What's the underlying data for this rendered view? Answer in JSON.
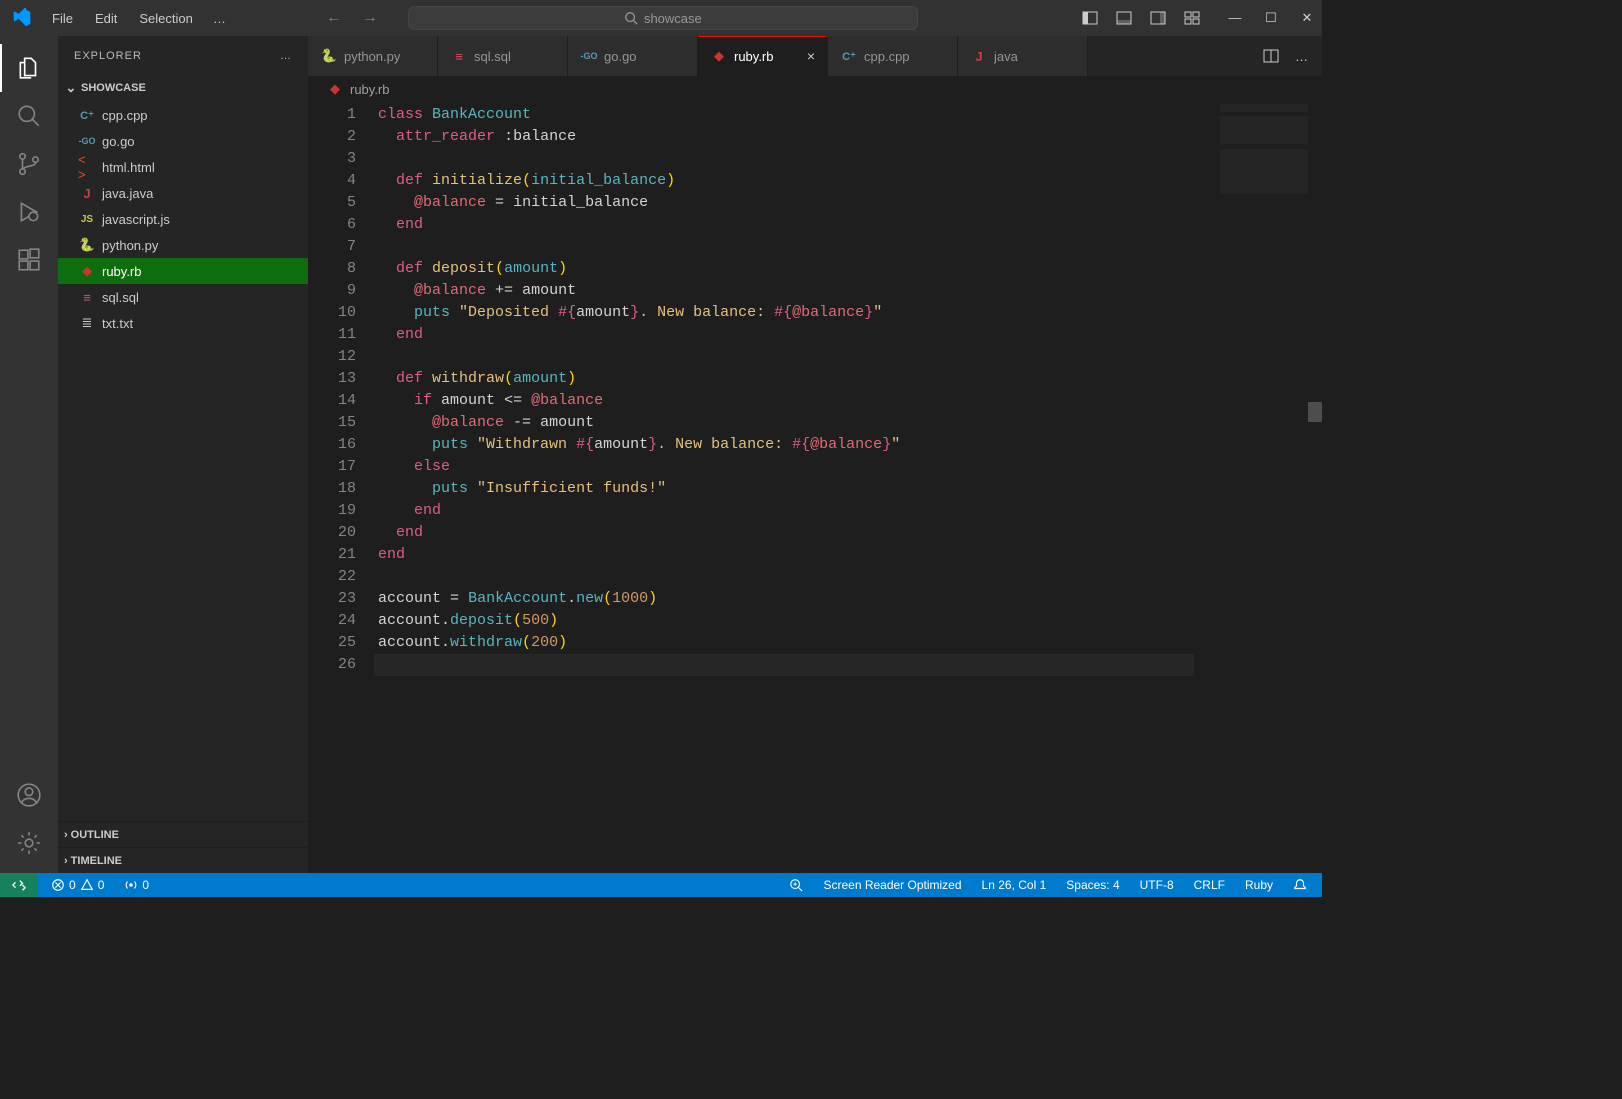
{
  "titlebar": {
    "menus": [
      "File",
      "Edit",
      "Selection"
    ],
    "search_placeholder": "showcase"
  },
  "activitybar": {
    "items": [
      "explorer",
      "search",
      "source-control",
      "run-debug",
      "extensions"
    ],
    "bottom": [
      "accounts",
      "manage"
    ]
  },
  "sidebar": {
    "title": "EXPLORER",
    "folder": "SHOWCASE",
    "files": [
      {
        "name": "cpp.cpp",
        "icon": "cpp",
        "active": false
      },
      {
        "name": "go.go",
        "icon": "go",
        "active": false
      },
      {
        "name": "html.html",
        "icon": "html",
        "active": false
      },
      {
        "name": "java.java",
        "icon": "java",
        "active": false
      },
      {
        "name": "javascript.js",
        "icon": "js",
        "active": false
      },
      {
        "name": "python.py",
        "icon": "py",
        "active": false
      },
      {
        "name": "ruby.rb",
        "icon": "rb",
        "active": true
      },
      {
        "name": "sql.sql",
        "icon": "sql",
        "active": false
      },
      {
        "name": "txt.txt",
        "icon": "txt",
        "active": false
      }
    ],
    "collapsed": [
      "OUTLINE",
      "TIMELINE"
    ]
  },
  "tabs": [
    {
      "name": "python.py",
      "icon": "py",
      "active": false
    },
    {
      "name": "sql.sql",
      "icon": "sql",
      "active": false
    },
    {
      "name": "go.go",
      "icon": "go",
      "active": false
    },
    {
      "name": "ruby.rb",
      "icon": "rb",
      "active": true
    },
    {
      "name": "cpp.cpp",
      "icon": "cpp",
      "active": false
    },
    {
      "name": "java",
      "icon": "java",
      "active": false
    }
  ],
  "breadcrumb": {
    "file": "ruby.rb",
    "icon": "rb"
  },
  "code": {
    "lines": 26,
    "content": [
      {
        "t": "class",
        "c": "kw-class"
      },
      {
        "sp": " "
      },
      {
        "t": "BankAccount",
        "c": "classname"
      },
      {
        "nl": 1
      },
      {
        "indent": 2
      },
      {
        "t": "attr_reader",
        "c": "accessor"
      },
      {
        "sp": " "
      },
      {
        "t": ":balance",
        "c": "sym"
      },
      {
        "nl": 1
      },
      {
        "nl": 1
      },
      {
        "indent": 2
      },
      {
        "t": "def",
        "c": "def"
      },
      {
        "sp": " "
      },
      {
        "t": "initialize",
        "c": "fn"
      },
      {
        "t": "(",
        "c": "paren"
      },
      {
        "t": "initial_balance",
        "c": "param"
      },
      {
        "t": ")",
        "c": "paren"
      },
      {
        "nl": 1
      },
      {
        "indent": 4
      },
      {
        "t": "@balance",
        "c": "ivar"
      },
      {
        "sp": " "
      },
      {
        "t": "=",
        "c": "op"
      },
      {
        "sp": " "
      },
      {
        "t": "initial_balance",
        "c": "ident"
      },
      {
        "nl": 1
      },
      {
        "indent": 2
      },
      {
        "t": "end",
        "c": "end"
      },
      {
        "nl": 1
      },
      {
        "nl": 1
      },
      {
        "indent": 2
      },
      {
        "t": "def",
        "c": "def"
      },
      {
        "sp": " "
      },
      {
        "t": "deposit",
        "c": "fn"
      },
      {
        "t": "(",
        "c": "paren"
      },
      {
        "t": "amount",
        "c": "param"
      },
      {
        "t": ")",
        "c": "paren"
      },
      {
        "nl": 1
      },
      {
        "indent": 4
      },
      {
        "t": "@balance",
        "c": "ivar"
      },
      {
        "sp": " "
      },
      {
        "t": "+=",
        "c": "op"
      },
      {
        "sp": " "
      },
      {
        "t": "amount",
        "c": "ident"
      },
      {
        "nl": 1
      },
      {
        "indent": 4
      },
      {
        "t": "puts",
        "c": "puts"
      },
      {
        "sp": " "
      },
      {
        "t": "\"Deposited ",
        "c": "str"
      },
      {
        "t": "#{",
        "c": "interp"
      },
      {
        "t": "amount",
        "c": "interp-v"
      },
      {
        "t": "}",
        "c": "interp"
      },
      {
        "t": ". New balance: ",
        "c": "str"
      },
      {
        "t": "#{",
        "c": "interp"
      },
      {
        "t": "@balance",
        "c": "ivar"
      },
      {
        "t": "}",
        "c": "interp"
      },
      {
        "t": "\"",
        "c": "str"
      },
      {
        "nl": 1
      },
      {
        "indent": 2
      },
      {
        "t": "end",
        "c": "end"
      },
      {
        "nl": 1
      },
      {
        "nl": 1
      },
      {
        "indent": 2
      },
      {
        "t": "def",
        "c": "def"
      },
      {
        "sp": " "
      },
      {
        "t": "withdraw",
        "c": "fn"
      },
      {
        "t": "(",
        "c": "paren"
      },
      {
        "t": "amount",
        "c": "param"
      },
      {
        "t": ")",
        "c": "paren"
      },
      {
        "nl": 1
      },
      {
        "indent": 4
      },
      {
        "t": "if",
        "c": "if"
      },
      {
        "sp": " "
      },
      {
        "t": "amount",
        "c": "ident"
      },
      {
        "sp": " "
      },
      {
        "t": "<=",
        "c": "op"
      },
      {
        "sp": " "
      },
      {
        "t": "@balance",
        "c": "ivar"
      },
      {
        "nl": 1
      },
      {
        "indent": 6
      },
      {
        "t": "@balance",
        "c": "ivar"
      },
      {
        "sp": " "
      },
      {
        "t": "-=",
        "c": "op"
      },
      {
        "sp": " "
      },
      {
        "t": "amount",
        "c": "ident"
      },
      {
        "nl": 1
      },
      {
        "indent": 6
      },
      {
        "t": "puts",
        "c": "puts"
      },
      {
        "sp": " "
      },
      {
        "t": "\"Withdrawn ",
        "c": "str"
      },
      {
        "t": "#{",
        "c": "interp"
      },
      {
        "t": "amount",
        "c": "interp-v"
      },
      {
        "t": "}",
        "c": "interp"
      },
      {
        "t": ". New balance: ",
        "c": "str"
      },
      {
        "t": "#{",
        "c": "interp"
      },
      {
        "t": "@balance",
        "c": "ivar"
      },
      {
        "t": "}",
        "c": "interp"
      },
      {
        "t": "\"",
        "c": "str"
      },
      {
        "nl": 1
      },
      {
        "indent": 4
      },
      {
        "t": "else",
        "c": "if"
      },
      {
        "nl": 1
      },
      {
        "indent": 6
      },
      {
        "t": "puts",
        "c": "puts"
      },
      {
        "sp": " "
      },
      {
        "t": "\"Insufficient funds!\"",
        "c": "str"
      },
      {
        "nl": 1
      },
      {
        "indent": 4
      },
      {
        "t": "end",
        "c": "end"
      },
      {
        "nl": 1
      },
      {
        "indent": 2
      },
      {
        "t": "end",
        "c": "end"
      },
      {
        "nl": 1
      },
      {
        "t": "end",
        "c": "end"
      },
      {
        "nl": 1
      },
      {
        "nl": 1
      },
      {
        "t": "account",
        "c": "ident"
      },
      {
        "sp": " "
      },
      {
        "t": "=",
        "c": "op"
      },
      {
        "sp": " "
      },
      {
        "t": "BankAccount",
        "c": "classname"
      },
      {
        "t": ".",
        "c": "dot"
      },
      {
        "t": "new",
        "c": "call"
      },
      {
        "t": "(",
        "c": "paren"
      },
      {
        "t": "1000",
        "c": "num"
      },
      {
        "t": ")",
        "c": "paren"
      },
      {
        "nl": 1
      },
      {
        "t": "account",
        "c": "ident"
      },
      {
        "t": ".",
        "c": "dot"
      },
      {
        "t": "deposit",
        "c": "call"
      },
      {
        "t": "(",
        "c": "paren"
      },
      {
        "t": "500",
        "c": "num"
      },
      {
        "t": ")",
        "c": "paren"
      },
      {
        "nl": 1
      },
      {
        "t": "account",
        "c": "ident"
      },
      {
        "t": ".",
        "c": "dot"
      },
      {
        "t": "withdraw",
        "c": "call"
      },
      {
        "t": "(",
        "c": "paren"
      },
      {
        "t": "200",
        "c": "num"
      },
      {
        "t": ")",
        "c": "paren"
      },
      {
        "nl": 1
      },
      {
        "cursor": true
      }
    ]
  },
  "statusbar": {
    "errors": "0",
    "warnings": "0",
    "ports": "0",
    "screen_reader": "Screen Reader Optimized",
    "ln_col": "Ln 26, Col 1",
    "spaces": "Spaces: 4",
    "encoding": "UTF-8",
    "eol": "CRLF",
    "lang": "Ruby"
  }
}
